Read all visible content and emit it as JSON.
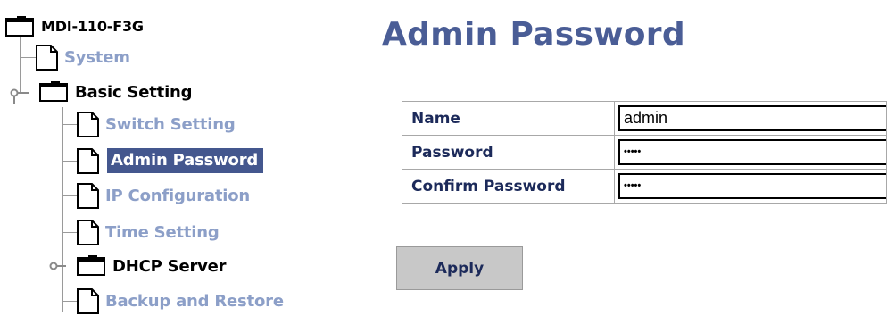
{
  "tree": {
    "root": "MDI-110-F3G",
    "system": "System",
    "basic_setting": "Basic Setting",
    "switch_setting": "Switch Setting",
    "admin_password": "Admin Password",
    "ip_configuration": "IP Configuration",
    "time_setting": "Time Setting",
    "dhcp_server": "DHCP Server",
    "backup_restore": "Backup and Restore",
    "selected_item": "Admin Password"
  },
  "page": {
    "title": "Admin Password"
  },
  "form": {
    "name_label": "Name",
    "name_value": "admin",
    "password_label": "Password",
    "password_value": "•••••",
    "confirm_label": "Confirm Password",
    "confirm_value": "•••••",
    "apply_label": "Apply"
  },
  "colors": {
    "title": "#4a5d96",
    "link": "#8c9fc8",
    "selected_bg": "#44578e",
    "button_bg": "#c8c8c8"
  }
}
